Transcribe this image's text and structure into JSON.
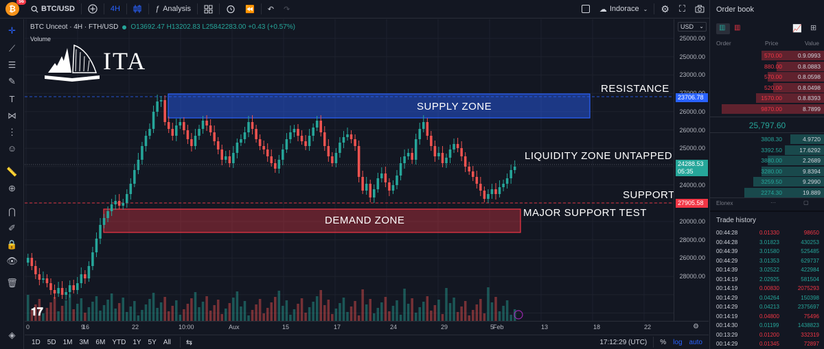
{
  "topbar": {
    "badge_count": "56",
    "symbol": "BTC/USD",
    "interval": "4H",
    "analysis_label": "Analysis",
    "indicator_name": "Indorace"
  },
  "legend": {
    "title": "BTC Unceot · 4H · FTH/USD",
    "ohlc": "O13692.47 H13202.83 L25842283.00 +0.43 (+0.57%)",
    "volume_label": "Volume"
  },
  "watermark": {
    "brand": "ITA"
  },
  "annotations": {
    "resistance": "RESISTANCE",
    "supply_zone": "SUPPLY ZONE",
    "liquidity": "LIQUIDITY ZONE UNTAPPED",
    "support": "SUPPORT",
    "major_support": "MAJOR SUPPORT TEST",
    "demand_zone": "DEMAND ZONE"
  },
  "price_axis": {
    "currency": "USD",
    "ticks": [
      "25000.00",
      "25000.00",
      "23000.00",
      "27000.00",
      "26000.00",
      "26000.00",
      "25000.00",
      "24000.00",
      "24000.00",
      "23500.00",
      "20000.00",
      "28000.00",
      "26000.00",
      "28000.00"
    ],
    "resistance_tag": "23706.78",
    "current_price_tag": "24288.53",
    "countdown_tag": "05:35",
    "support_tag": "27905.58",
    "colors": {
      "resistance": "#2962ff",
      "current": "#26a69a",
      "support": "#f23645"
    }
  },
  "time_axis": {
    "ticks": [
      "0",
      "9",
      "16",
      "22",
      "10:00",
      "Aux",
      "15",
      "17",
      "24",
      "29",
      "5",
      "Feb",
      "13",
      "18",
      "22"
    ]
  },
  "bottombar": {
    "ranges": [
      "1D",
      "5D",
      "1M",
      "3M",
      "6M",
      "YTD",
      "1Y",
      "5Y",
      "All"
    ],
    "clock": "17:12:29 (UTC)",
    "pct": "%",
    "log": "log",
    "auto": "auto"
  },
  "orderbook": {
    "title": "Order book",
    "headers": [
      "Order",
      "Price",
      "Value"
    ],
    "asks": [
      {
        "price": "570.00",
        "value": "0.9.0993",
        "depth": 0.55
      },
      {
        "price": "880.00",
        "value": "0.8.0883",
        "depth": 0.42
      },
      {
        "price": "570.00",
        "value": "0.8.0598",
        "depth": 0.5
      },
      {
        "price": "520.00",
        "value": "0.8.0498",
        "depth": 0.45
      },
      {
        "price": "1570.00",
        "value": "0.8.8393",
        "depth": 0.6
      },
      {
        "price": "9870.00",
        "value": "8.7899",
        "depth": 0.9
      }
    ],
    "last_price": "25,797.60",
    "bids": [
      {
        "price": "3808.30",
        "value": "4.9720",
        "depth": 0.3
      },
      {
        "price": "3392.50",
        "value": "17.6292",
        "depth": 0.35
      },
      {
        "price": "3880.00",
        "value": "2.2689",
        "depth": 0.5
      },
      {
        "price": "3280.00",
        "value": "9.8394",
        "depth": 0.55
      },
      {
        "price": "3259.50",
        "value": "9.2990",
        "depth": 0.62
      },
      {
        "price": "2274.30",
        "value": "19.889",
        "depth": 0.7
      }
    ],
    "footer_label": "Elonex"
  },
  "trade_history": {
    "title": "Trade history",
    "rows": [
      {
        "time": "00:44:28",
        "price": "0.01330",
        "value": "98650",
        "side": "sell"
      },
      {
        "time": "00:44:28",
        "price": "3.01823",
        "value": "430253",
        "side": "buy"
      },
      {
        "time": "00:44:39",
        "price": "3.01580",
        "value": "525485",
        "side": "buy"
      },
      {
        "time": "00:44:29",
        "price": "3.01353",
        "value": "629737",
        "side": "buy"
      },
      {
        "time": "00:14:39",
        "price": "3.02522",
        "value": "422984",
        "side": "buy"
      },
      {
        "time": "00:14:19",
        "price": "2.02925",
        "value": "581504",
        "side": "buy"
      },
      {
        "time": "00:14:19",
        "price": "0.00830",
        "value": "2075293",
        "side": "sell"
      },
      {
        "time": "00:14:29",
        "price": "0.04264",
        "value": "150398",
        "side": "buy"
      },
      {
        "time": "00:14:29",
        "price": "0.04213",
        "value": "2375697",
        "side": "buy"
      },
      {
        "time": "00:14:19",
        "price": "0.04800",
        "value": "75496",
        "side": "sell"
      },
      {
        "time": "00:14:30",
        "price": "0.01199",
        "value": "1438823",
        "side": "buy"
      },
      {
        "time": "00:13:29",
        "price": "0.01200",
        "value": "332319",
        "side": "sell"
      },
      {
        "time": "00:14:29",
        "price": "0.01345",
        "value": "72897",
        "side": "sell"
      }
    ]
  }
}
